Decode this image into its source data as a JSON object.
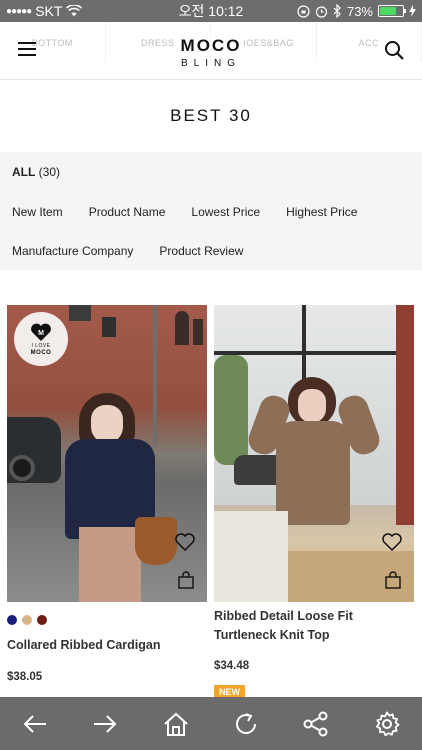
{
  "status_bar": {
    "carrier": "SKT",
    "time": "오전 10:12",
    "battery": "73%",
    "battery_level": 0.73
  },
  "header": {
    "categories": [
      "BOTTOM",
      "DRESS",
      "SHOES&BAG",
      "ACC"
    ],
    "logo_line1": "MOCO",
    "logo_line2": "BLING",
    "menu_icon": "hamburger-icon",
    "search_icon": "search-icon"
  },
  "page": {
    "title": "BEST 30"
  },
  "filter": {
    "all_label": "ALL",
    "all_count": "(30)",
    "sort_options_row1": [
      "New Item",
      "Product Name",
      "Lowest Price",
      "Highest Price"
    ],
    "sort_options_row2": [
      "Manufacture Company",
      "Product Review"
    ]
  },
  "products": [
    {
      "name": "Collared Ribbed Cardigan",
      "price": "$38.05",
      "swatches": [
        "#1a1f7a",
        "#d9b48a",
        "#6b1d12"
      ],
      "badge_line1": "I LOVE",
      "badge_line2": "MOCO"
    },
    {
      "name": "Ribbed Detail Loose Fit Turtleneck Knit Top",
      "price": "$34.48",
      "badge": "NEW"
    }
  ],
  "toolbar": {
    "icons": [
      "back-arrow-icon",
      "forward-arrow-icon",
      "home-icon",
      "refresh-icon",
      "share-icon",
      "settings-icon"
    ]
  },
  "colors": {
    "status_bar_bg": "#6d6d6d",
    "toolbar_bg": "#6b6b6b",
    "filter_bg": "#f5f5f5",
    "new_badge": "#f3a42a",
    "battery_fill": "#4cd964"
  }
}
